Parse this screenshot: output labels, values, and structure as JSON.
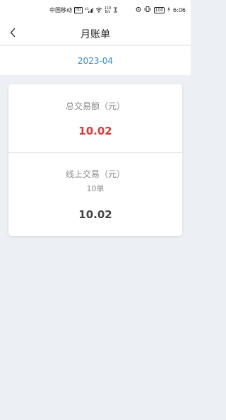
{
  "status_bar": {
    "carrier": "中国移动",
    "hd": "HD",
    "network": "4G",
    "speed_value": "119",
    "speed_unit": "B/s",
    "battery": "100",
    "time": "6:06"
  },
  "header": {
    "title": "月账单"
  },
  "month": {
    "value": "2023-04"
  },
  "summary": {
    "total_label": "总交易额（元）",
    "total_amount": "10.02",
    "online_label": "线上交易（元）",
    "online_count": "10单",
    "online_amount": "10.02"
  },
  "colors": {
    "accent_blue": "#2a8ad8",
    "amount_red": "#e03a3a",
    "background": "#eceff3"
  },
  "icons": {
    "back": "chevron-left-icon"
  }
}
